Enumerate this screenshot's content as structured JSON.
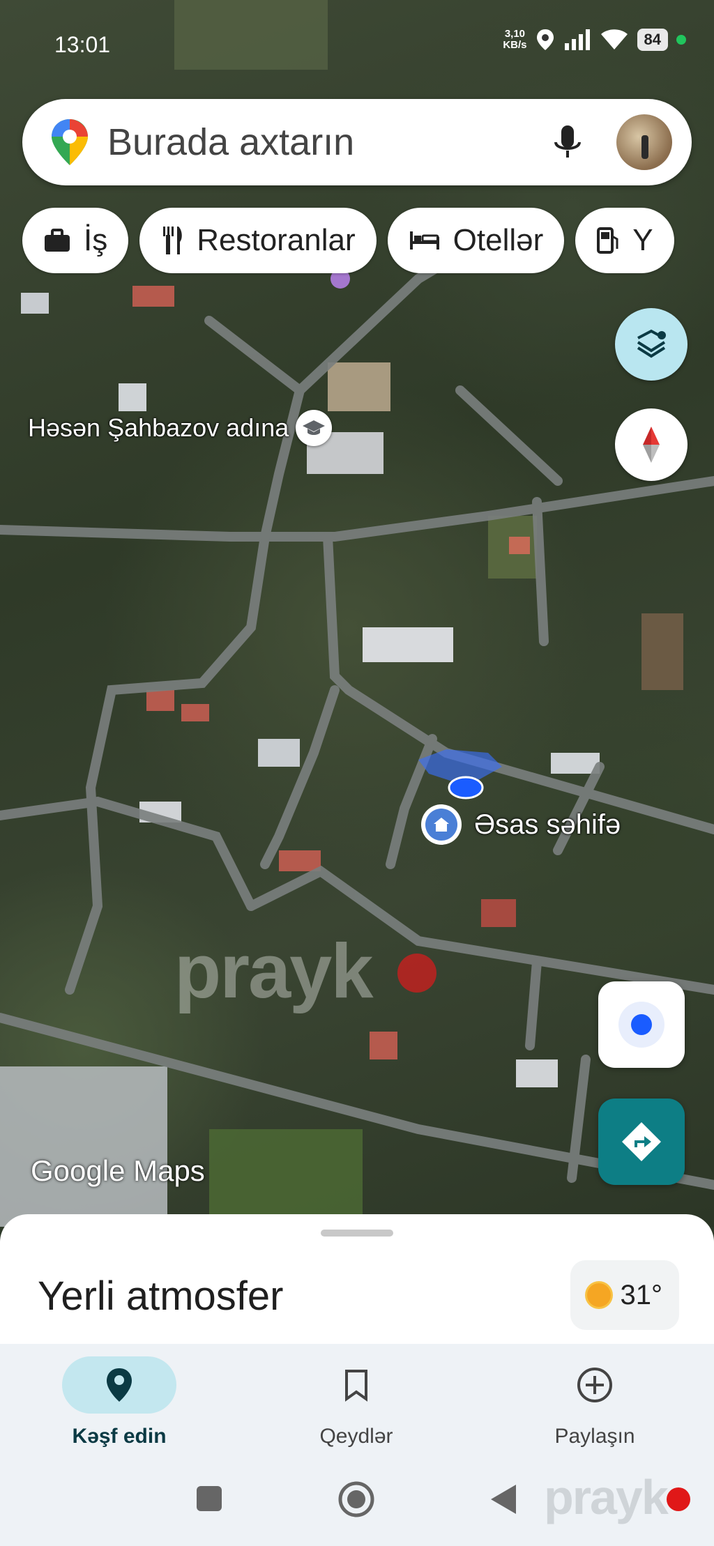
{
  "status_bar": {
    "time": "13:01",
    "net_speed_top": "3,10",
    "net_speed_unit": "KB/s",
    "battery": "84"
  },
  "search": {
    "placeholder": "Burada axtarın"
  },
  "chips": [
    {
      "label": "İş",
      "icon": "briefcase-icon"
    },
    {
      "label": "Restoranlar",
      "icon": "fork-knife-icon"
    },
    {
      "label": "Otellər",
      "icon": "bed-icon"
    },
    {
      "label": "Y",
      "icon": "fuel-icon"
    }
  ],
  "map": {
    "school_label": "Həsən Şahbazov adına",
    "home_label": "Əsas səhifə",
    "attribution": "Google Maps",
    "watermark": "prayk"
  },
  "sheet": {
    "title": "Yerli atmosfer",
    "temperature": "31°"
  },
  "nav": {
    "items": [
      {
        "label": "Kəşf edin",
        "icon": "explore-pin-icon",
        "active": true
      },
      {
        "label": "Qeydlər",
        "icon": "bookmark-icon",
        "active": false
      },
      {
        "label": "Paylaşın",
        "icon": "add-circle-icon",
        "active": false
      }
    ]
  },
  "corner_watermark": "prayk",
  "colors": {
    "accent": "#0d7e85",
    "active_pill": "#c3e7ef",
    "layers_fab": "#b9e6f0"
  }
}
